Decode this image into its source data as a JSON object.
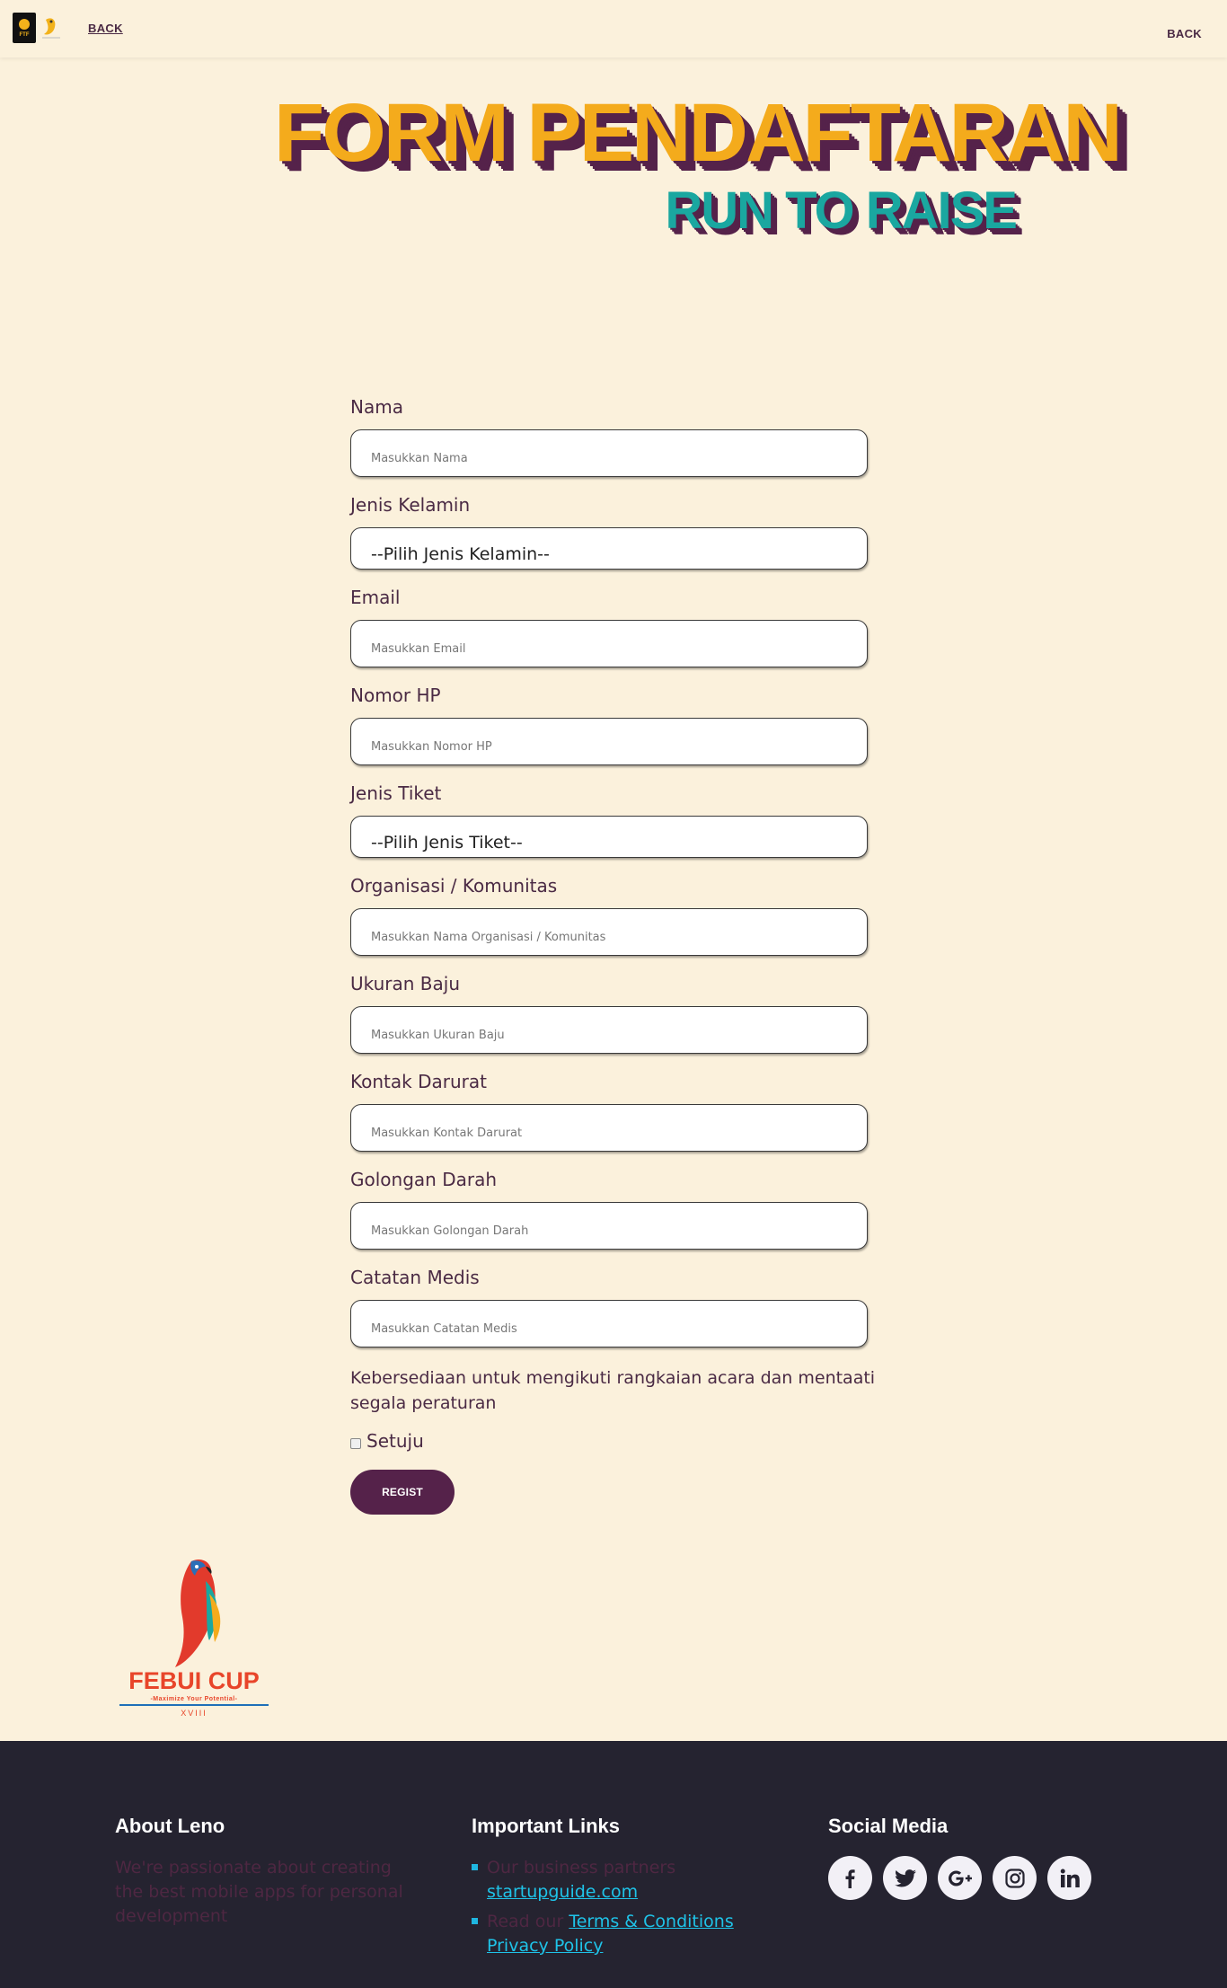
{
  "nav": {
    "logo_text": "FTF",
    "back_left": "BACK",
    "back_right": "BACK"
  },
  "header": {
    "title": "FORM PENDAFTARAN",
    "subtitle": "RUN TO RAISE"
  },
  "form": {
    "fields": [
      {
        "label": "Nama",
        "placeholder": "Masukkan Nama",
        "type": "input"
      },
      {
        "label": "Jenis Kelamin",
        "value": "--Pilih Jenis Kelamin--",
        "type": "select"
      },
      {
        "label": "Email",
        "placeholder": "Masukkan Email",
        "type": "input"
      },
      {
        "label": "Nomor HP",
        "placeholder": "Masukkan Nomor HP",
        "type": "input"
      },
      {
        "label": "Jenis Tiket",
        "value": "--Pilih Jenis Tiket--",
        "type": "select"
      },
      {
        "label": "Organisasi / Komunitas",
        "placeholder": "Masukkan Nama Organisasi /  Komunitas",
        "type": "input"
      },
      {
        "label": "Ukuran Baju",
        "placeholder": "Masukkan Ukuran Baju",
        "type": "input"
      },
      {
        "label": "Kontak Darurat",
        "placeholder": "Masukkan Kontak Darurat",
        "type": "input"
      },
      {
        "label": "Golongan Darah",
        "placeholder": "Masukkan Golongan Darah",
        "type": "input"
      },
      {
        "label": "Catatan Medis",
        "placeholder": "Masukkan Catatan Medis",
        "type": "input"
      }
    ],
    "agreement_text": "Kebersediaan untuk mengikuti rangkaian acara dan mentaati segala peraturan",
    "checkbox_label": "Setuju",
    "submit_label": "REGIST"
  },
  "event_logo": {
    "name": "FEBUI CUP",
    "tagline": "-Maximize Your Potential-",
    "edition": "XVIII"
  },
  "footer": {
    "about": {
      "title": "About Leno",
      "text": "We're passionate about creating the best mobile apps for personal development"
    },
    "links": {
      "title": "Important Links",
      "item1_prefix": "Our business partners",
      "item1_link": "startupguide.com",
      "item2_prefix": "Read our",
      "item2_link1": "Terms & Conditions",
      "item2_link2": "Privacy Policy"
    },
    "social": {
      "title": "Social Media",
      "icons": [
        "facebook-icon",
        "twitter-icon",
        "google-plus-icon",
        "instagram-icon",
        "linkedin-icon"
      ]
    }
  },
  "colors": {
    "background": "#fbf1dc",
    "primary": "#55224a",
    "title_yellow": "#f4ab1c",
    "subtitle_teal": "#1aa7a0",
    "footer_bg": "#252330",
    "link": "#1fc3e8"
  }
}
